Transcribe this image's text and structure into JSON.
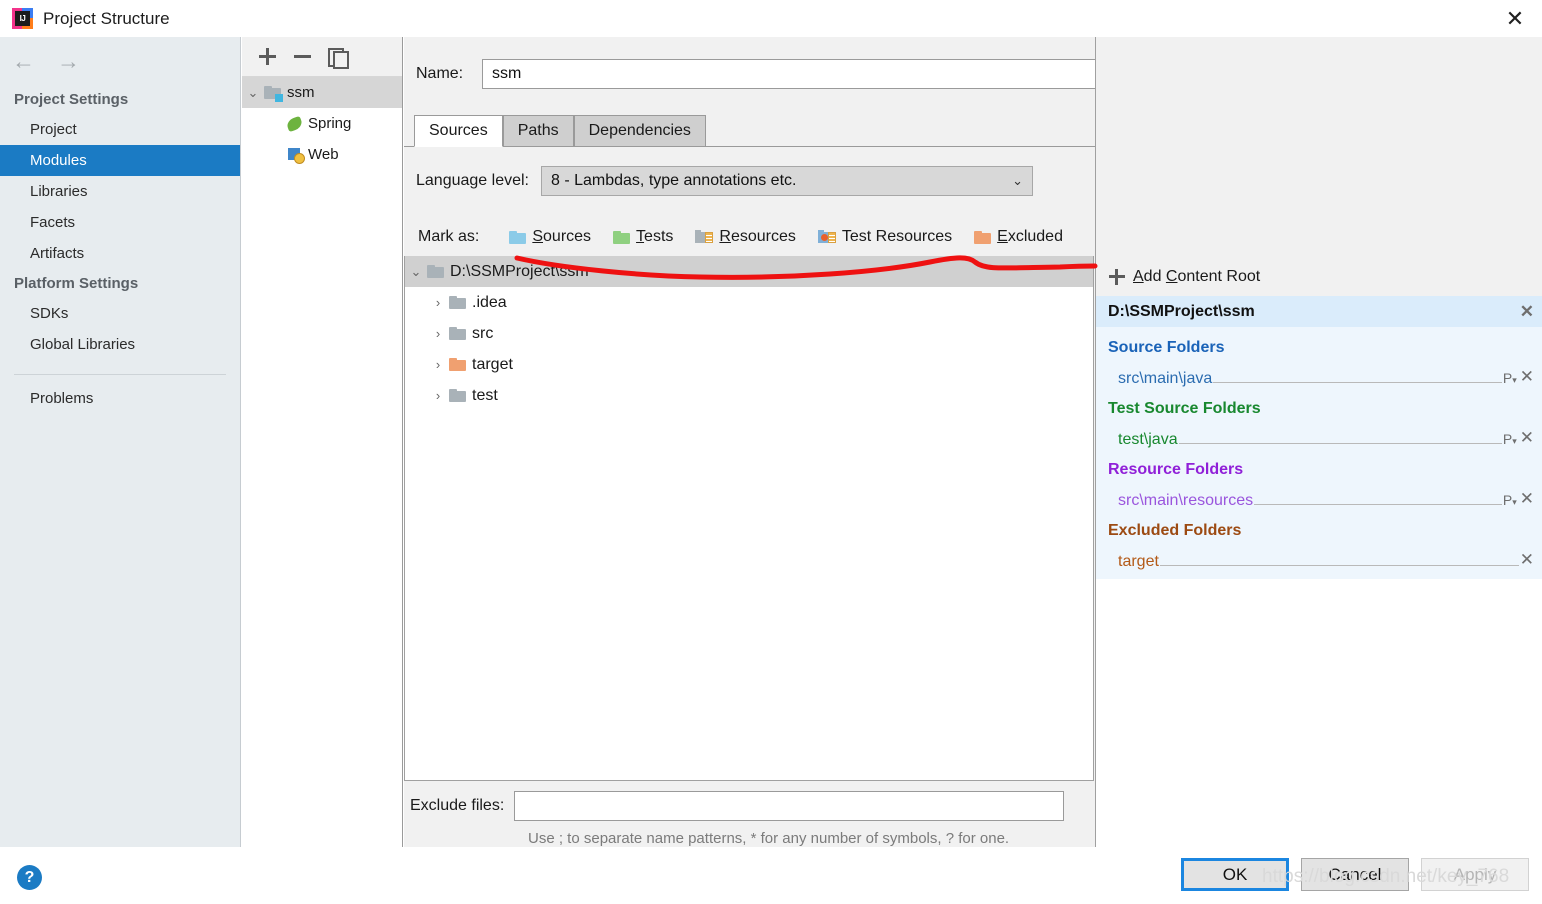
{
  "window": {
    "title": "Project Structure",
    "logo_icon": "intellij-idea-logo",
    "close_icon": "✕"
  },
  "sidebar": {
    "back_icon": "←",
    "forward_icon": "→",
    "groups": [
      {
        "label": "Project Settings"
      },
      {
        "label": "Platform Settings"
      }
    ],
    "items": [
      {
        "label": "Project",
        "selected": false
      },
      {
        "label": "Modules",
        "selected": true
      },
      {
        "label": "Libraries",
        "selected": false
      },
      {
        "label": "Facets",
        "selected": false
      },
      {
        "label": "Artifacts",
        "selected": false
      },
      {
        "label": "SDKs",
        "selected": false
      },
      {
        "label": "Global Libraries",
        "selected": false
      },
      {
        "label": "Problems",
        "selected": false
      }
    ],
    "selected_color": "#1b7bc4"
  },
  "modules_panel": {
    "toolbar": {
      "add_icon": "plus-icon",
      "remove_icon": "minus-icon",
      "copy_icon": "copy-icon"
    },
    "tree": [
      {
        "label": "ssm",
        "icon": "module-folder-icon",
        "expanded": true,
        "selected": true
      },
      {
        "label": "Spring",
        "icon": "spring-leaf-icon",
        "selected": false
      },
      {
        "label": "Web",
        "icon": "web-globe-icon",
        "selected": false
      }
    ]
  },
  "main": {
    "name_label": "Name:",
    "name_value": "ssm",
    "tabs": [
      {
        "label": "Sources",
        "active": true
      },
      {
        "label": "Paths",
        "active": false
      },
      {
        "label": "Dependencies",
        "active": false
      }
    ],
    "language_level_label": "Language level:",
    "language_level_value": "8 - Lambdas, type annotations etc.",
    "combo_arrow_icon": "chevron-down-icon",
    "mark_as_label": "Mark as:",
    "mark_as": [
      {
        "label": "Sources",
        "mnemonic": "S",
        "icon": "folder-blue-icon",
        "color": "#8bcbe8"
      },
      {
        "label": "Tests",
        "mnemonic": "T",
        "icon": "folder-green-icon",
        "color": "#8fd080"
      },
      {
        "label": "Resources",
        "mnemonic": "R",
        "icon": "folder-resources-icon",
        "color": "#a9b2b8"
      },
      {
        "label": "Test Resources",
        "mnemonic": "",
        "icon": "folder-test-resources-icon",
        "color": "#7fb0d8"
      },
      {
        "label": "Excluded",
        "mnemonic": "E",
        "icon": "folder-orange-icon",
        "color": "#f0a070"
      }
    ],
    "tree": [
      {
        "label": "D:\\SSMProject\\ssm",
        "icon": "folder-grey-icon",
        "depth": 0,
        "expanded": true,
        "selected": true,
        "chevron": "⌄"
      },
      {
        "label": ".idea",
        "icon": "folder-grey-icon",
        "depth": 1,
        "expanded": false,
        "selected": false,
        "chevron": "›"
      },
      {
        "label": "src",
        "icon": "folder-grey-icon",
        "depth": 1,
        "expanded": false,
        "selected": false,
        "chevron": "›"
      },
      {
        "label": "target",
        "icon": "folder-orange-icon",
        "depth": 1,
        "expanded": false,
        "selected": false,
        "chevron": "›"
      },
      {
        "label": "test",
        "icon": "folder-grey-icon",
        "depth": 1,
        "expanded": false,
        "selected": false,
        "chevron": "›"
      }
    ],
    "exclude_files_label": "Exclude files:",
    "exclude_files_value": "",
    "exclude_hint": "Use ; to separate name patterns, * for any number of symbols, ? for one."
  },
  "content_root_panel": {
    "add_content_root_label": "Add Content Root",
    "add_icon": "plus-icon",
    "root_path": "D:\\SSMProject\\ssm",
    "remove_root_icon": "✕",
    "groups": [
      {
        "title": "Source Folders",
        "color": "#1a63b8",
        "entries": [
          {
            "path": "src\\main\\java",
            "has_package_prefix": true,
            "package_prefix_icon": "package-prefix-icon",
            "close_icon": "✕"
          }
        ]
      },
      {
        "title": "Test Source Folders",
        "color": "#18882f",
        "entries": [
          {
            "path": "test\\java",
            "has_package_prefix": true,
            "package_prefix_icon": "package-prefix-icon",
            "close_icon": "✕"
          }
        ]
      },
      {
        "title": "Resource Folders",
        "color": "#9020d8",
        "entries": [
          {
            "path": "src\\main\\resources",
            "has_package_prefix": true,
            "package_prefix_icon": "package-prefix-icon",
            "close_icon": "✕"
          }
        ]
      },
      {
        "title": "Excluded Folders",
        "color": "#9c4a12",
        "entries": [
          {
            "path": "target",
            "has_package_prefix": false,
            "package_prefix_icon": "",
            "close_icon": "✕"
          }
        ]
      }
    ]
  },
  "footer": {
    "help_label": "?",
    "ok_label": "OK",
    "cancel_label": "Cancel",
    "apply_label": "Apply"
  },
  "annotation": {
    "color": "#ee1111",
    "type": "hand-drawn-underline"
  },
  "watermark": {
    "text": "https://blog.csdn.net/key_768"
  }
}
